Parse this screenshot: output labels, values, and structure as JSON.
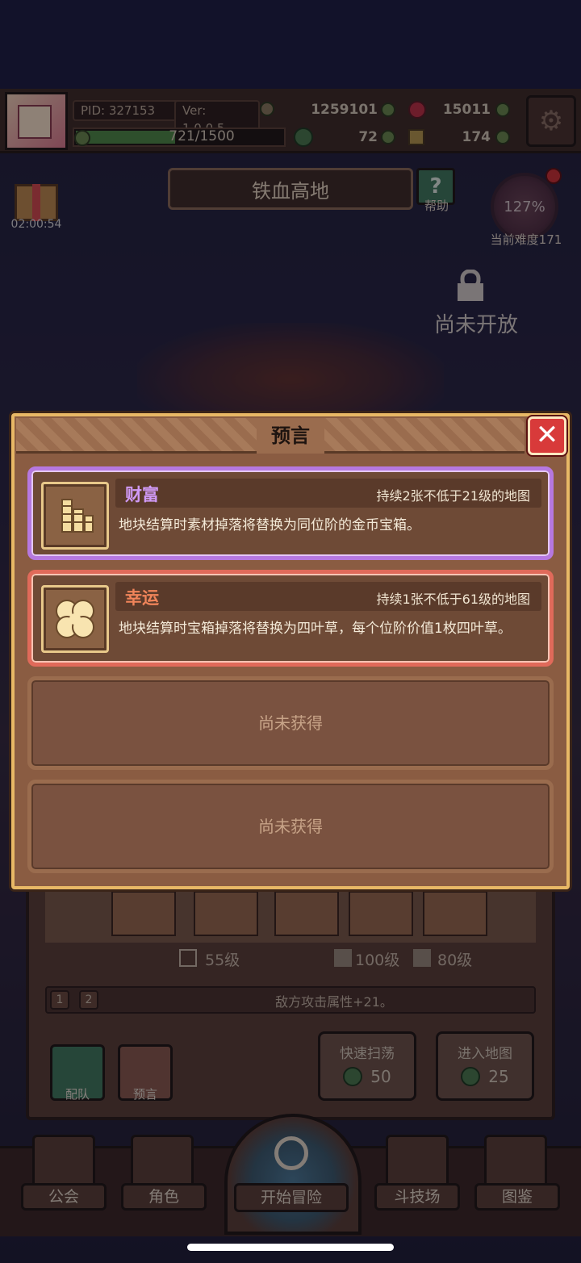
{
  "hud": {
    "pid": "PID: 327153",
    "version": "Ver: 1.0.0.5",
    "gold": "1259101",
    "gems": "15011",
    "exp": "721/1500",
    "exp_ratio": 0.48,
    "clover_count": "72",
    "key_count": "174"
  },
  "map": {
    "title": "铁血高地",
    "help_label": "帮助",
    "gift_timer": "02:00:54",
    "difficulty_percent": "127%",
    "difficulty_label": "当前难度171",
    "locked_label": "尚未开放"
  },
  "panel": {
    "levels": [
      "55级",
      "100级",
      "80级"
    ],
    "buff_pages": [
      "1",
      "2"
    ],
    "buff_text": "敌方攻击属性+21。",
    "team_button": "配队",
    "prophecy_button": "预言",
    "sweep_label": "快速扫荡",
    "sweep_cost": "50",
    "enter_label": "进入地图",
    "enter_cost": "25"
  },
  "nav": {
    "guild": "公会",
    "character": "角色",
    "start": "开始冒险",
    "arena": "斗技场",
    "codex": "图鉴"
  },
  "modal": {
    "title": "预言",
    "close_icon": "close-icon",
    "cards": [
      {
        "name": "财富",
        "condition": "持续2张不低于21级的地图",
        "description": "地块结算时素材掉落将替换为同位阶的金币宝箱。",
        "icon": "gold-stack-icon",
        "color": "#b678e0"
      },
      {
        "name": "幸运",
        "condition": "持续1张不低于61级的地图",
        "description": "地块结算时宝箱掉落将替换为四叶草，每个位阶价值1枚四叶草。",
        "icon": "four-leaf-clover-icon",
        "color": "#e06a5a"
      }
    ],
    "empty_slots": [
      "尚未获得",
      "尚未获得"
    ]
  },
  "colors": {
    "modal_border": "#e8b866",
    "close_red": "#d83a3a",
    "wealth_purple": "#b678e0",
    "luck_red": "#e06a5a"
  }
}
